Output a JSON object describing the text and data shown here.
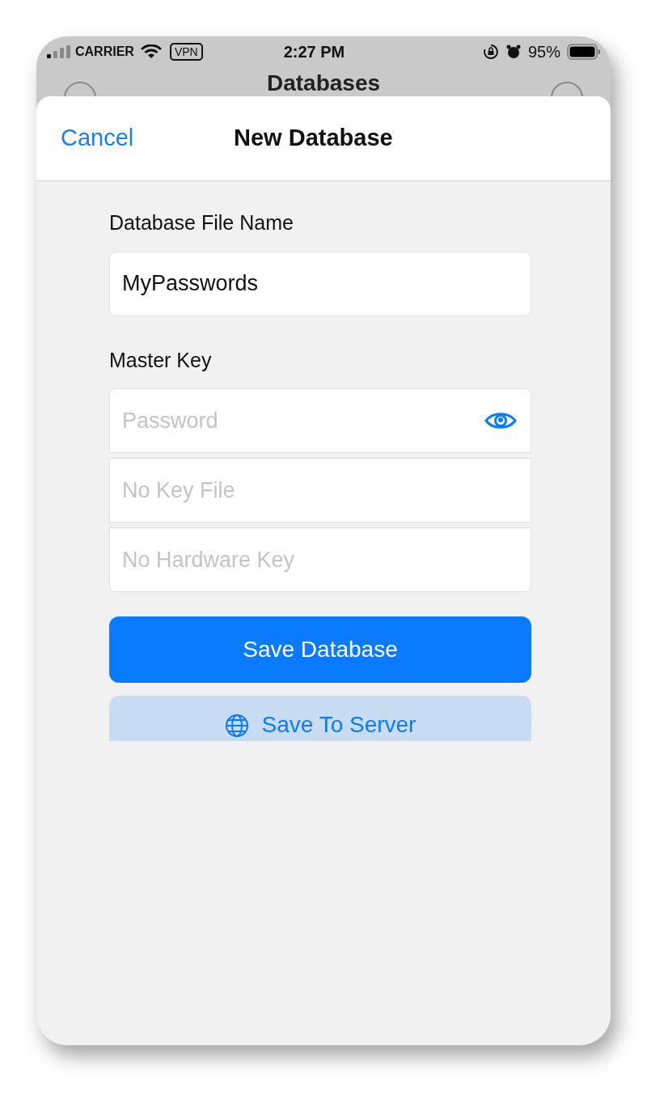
{
  "status_bar": {
    "carrier": "CARRIER",
    "vpn": "VPN",
    "time": "2:27 PM",
    "battery": "95%"
  },
  "background_nav": {
    "title": "Databases"
  },
  "sheet": {
    "cancel": "Cancel",
    "title": "New Database"
  },
  "file_name": {
    "label": "Database File Name",
    "value": "MyPasswords"
  },
  "master_key": {
    "label": "Master Key",
    "fields": [
      {
        "placeholder": "Password",
        "kind": "password"
      },
      {
        "placeholder": "No Key File",
        "kind": "plain"
      },
      {
        "placeholder": "No Hardware Key",
        "kind": "plain"
      }
    ]
  },
  "buttons": [
    {
      "label": "Save Database",
      "kind": "primary"
    },
    {
      "label": "Save To Server",
      "kind": "server"
    }
  ]
}
